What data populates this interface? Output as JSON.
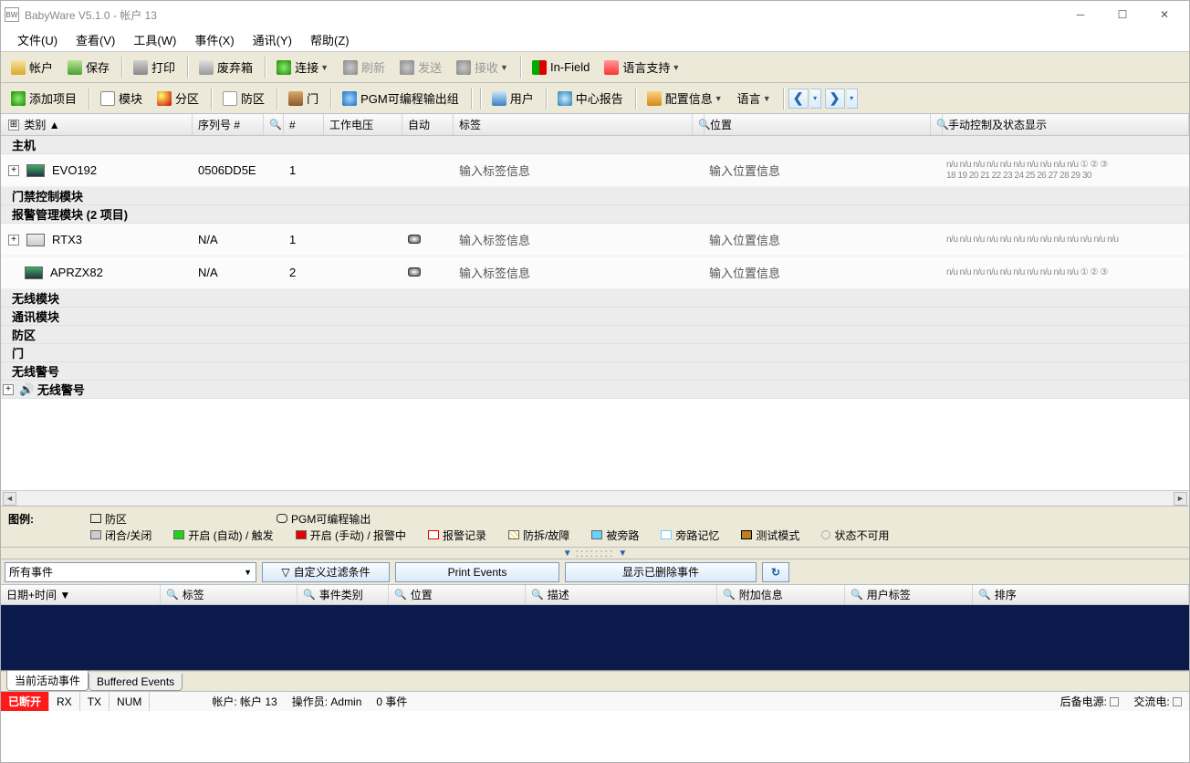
{
  "title": "BabyWare V5.1.0 - 帐户 13",
  "menu": {
    "file": "文件(U)",
    "view": "查看(V)",
    "tools": "工具(W)",
    "events": "事件(X)",
    "comm": "通讯(Y)",
    "help": "帮助(Z)"
  },
  "toolbar1": {
    "account": "帐户",
    "save": "保存",
    "print": "打印",
    "trash": "废弃箱",
    "connect": "连接",
    "refresh": "刷新",
    "send": "发送",
    "receive": "接收",
    "infield": "In-Field",
    "lang": "语言支持"
  },
  "toolbar2": {
    "add": "添加项目",
    "module": "模块",
    "partition": "分区",
    "zone": "防区",
    "door": "门",
    "pgm": "PGM可编程输出组",
    "user": "用户",
    "centralreport": "中心报告",
    "config": "配置信息",
    "language": "语言"
  },
  "gridHeader": {
    "category": "类别",
    "serial": "序列号 #",
    "num": "#",
    "voltage": "工作电压",
    "auto": "自动",
    "label": "标签",
    "position": "位置",
    "manual": "手动控制及状态显示"
  },
  "groups": {
    "host": "主机",
    "access": "门禁控制模块",
    "alarm": "报警管理模块 (2 项目)",
    "wireless": "无线模块",
    "comm": "通讯模块",
    "zone": "防区",
    "door": "门",
    "siren": "无线警号",
    "siren2": "无线警号"
  },
  "rows": [
    {
      "name": "EVO192",
      "serial": "0506DD5E",
      "num": "1",
      "label": "输入标签信息",
      "pos": "输入位置信息",
      "manual": "n/u n/u n/u n/u n/u n/u n/u n/u n/u n/u ① ② ③",
      "manual2": "18 19 20 21 22 23 24 25 26 27 28 29 30"
    },
    {
      "name": "RTX3",
      "serial": "N/A",
      "num": "1",
      "label": "输入标签信息",
      "pos": "输入位置信息",
      "manual": "n/u n/u n/u n/u n/u n/u n/u n/u n/u n/u n/u n/u n/u"
    },
    {
      "name": "APRZX82",
      "serial": "N/A",
      "num": "2",
      "label": "输入标签信息",
      "pos": "输入位置信息",
      "manual": "n/u n/u n/u n/u n/u n/u n/u n/u n/u n/u ① ② ③"
    }
  ],
  "legend": {
    "title": "图例:",
    "zone": "防区",
    "pgm": "PGM可编程输出",
    "closed": "闭合/关闭",
    "openauto": "开启 (自动) / 触发",
    "openmanual": "开启 (手动) / 报警中",
    "alarmrec": "报警记录",
    "tamper": "防拆/故障",
    "bypass": "被旁路",
    "bypassmem": "旁路记忆",
    "test": "测试模式",
    "unavail": "状态不可用"
  },
  "events": {
    "filter": "所有事件",
    "custom": "自定义过滤条件",
    "print": "Print Events",
    "showdel": "显示已删除事件"
  },
  "eventHeader": {
    "datetime": "日期+时间",
    "label": "标签",
    "type": "事件类别",
    "position": "位置",
    "desc": "描述",
    "extra": "附加信息",
    "userlabel": "用户标签",
    "sort": "排序"
  },
  "tabs": {
    "current": "当前活动事件",
    "buffered": "Buffered Events"
  },
  "status": {
    "conn": "已断开",
    "rx": "RX",
    "tx": "TX",
    "num": "NUM",
    "account": "帐户: 帐户 13",
    "operator": "操作员: Admin",
    "events": "0 事件",
    "backup": "后备电源:",
    "ac": "交流电:"
  }
}
